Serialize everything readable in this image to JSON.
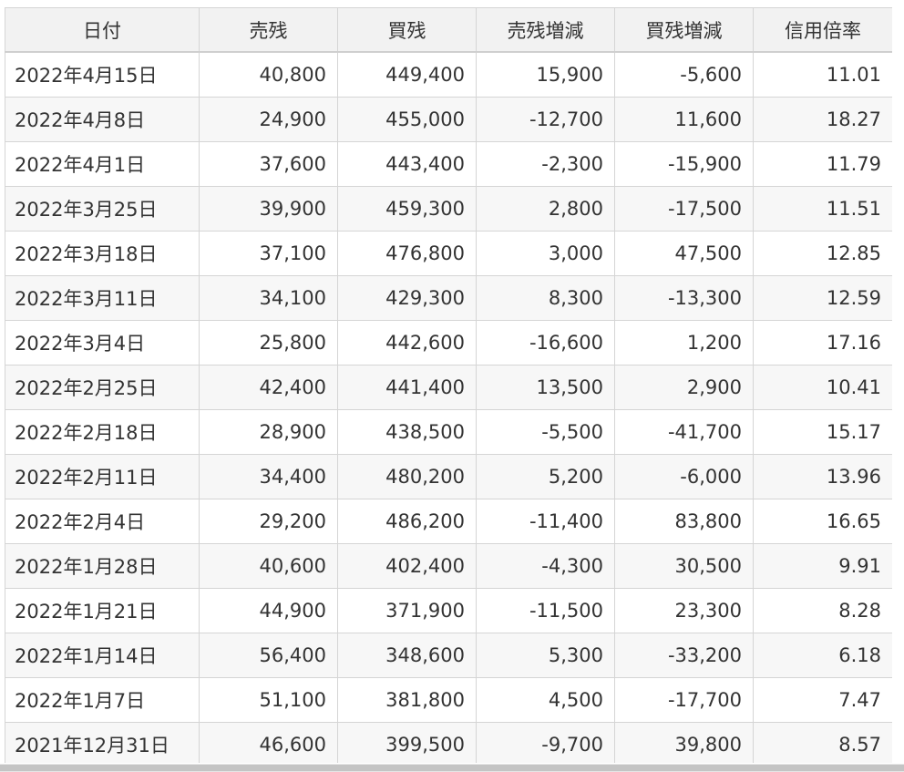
{
  "table": {
    "headers": [
      "日付",
      "売残",
      "買残",
      "売残増減",
      "買残増減",
      "信用倍率"
    ],
    "rows": [
      [
        "2022年4月15日",
        "40,800",
        "449,400",
        "15,900",
        "-5,600",
        "11.01"
      ],
      [
        "2022年4月8日",
        "24,900",
        "455,000",
        "-12,700",
        "11,600",
        "18.27"
      ],
      [
        "2022年4月1日",
        "37,600",
        "443,400",
        "-2,300",
        "-15,900",
        "11.79"
      ],
      [
        "2022年3月25日",
        "39,900",
        "459,300",
        "2,800",
        "-17,500",
        "11.51"
      ],
      [
        "2022年3月18日",
        "37,100",
        "476,800",
        "3,000",
        "47,500",
        "12.85"
      ],
      [
        "2022年3月11日",
        "34,100",
        "429,300",
        "8,300",
        "-13,300",
        "12.59"
      ],
      [
        "2022年3月4日",
        "25,800",
        "442,600",
        "-16,600",
        "1,200",
        "17.16"
      ],
      [
        "2022年2月25日",
        "42,400",
        "441,400",
        "13,500",
        "2,900",
        "10.41"
      ],
      [
        "2022年2月18日",
        "28,900",
        "438,500",
        "-5,500",
        "-41,700",
        "15.17"
      ],
      [
        "2022年2月11日",
        "34,400",
        "480,200",
        "5,200",
        "-6,000",
        "13.96"
      ],
      [
        "2022年2月4日",
        "29,200",
        "486,200",
        "-11,400",
        "83,800",
        "16.65"
      ],
      [
        "2022年1月28日",
        "40,600",
        "402,400",
        "-4,300",
        "30,500",
        "9.91"
      ],
      [
        "2022年1月21日",
        "44,900",
        "371,900",
        "-11,500",
        "23,300",
        "8.28"
      ],
      [
        "2022年1月14日",
        "56,400",
        "348,600",
        "5,300",
        "-33,200",
        "6.18"
      ],
      [
        "2022年1月7日",
        "51,100",
        "381,800",
        "4,500",
        "-17,700",
        "7.47"
      ],
      [
        "2021年12月31日",
        "46,600",
        "399,500",
        "-9,700",
        "39,800",
        "8.57"
      ]
    ]
  }
}
